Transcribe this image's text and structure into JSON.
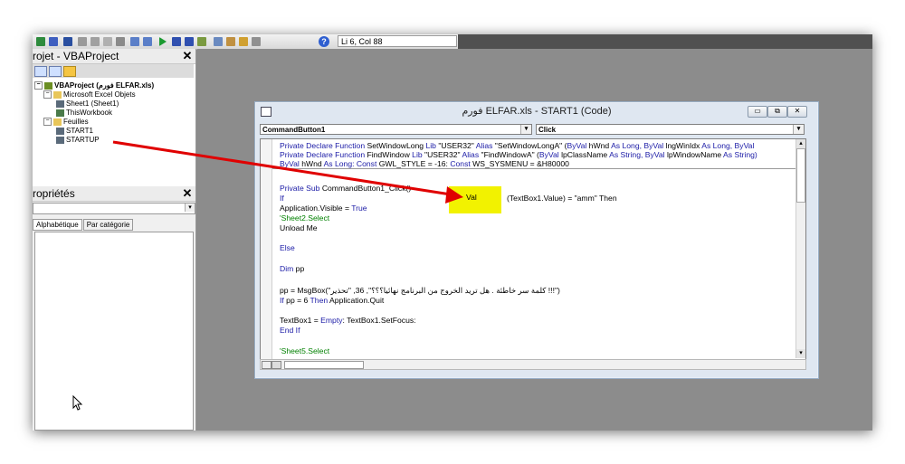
{
  "toolbar": {
    "cursor_position": "Li 6, Col 88",
    "help_glyph": "?"
  },
  "project_panel": {
    "title": "rojet - VBAProject",
    "close_glyph": "✕",
    "tree": [
      {
        "label": "VBAProject (فورم ELFAR.xls)",
        "expander": "−"
      },
      {
        "label": "Microsoft Excel Objets",
        "expander": "−"
      },
      {
        "label": "Sheet1 (Sheet1)"
      },
      {
        "label": "ThisWorkbook"
      },
      {
        "label": "Feuilles",
        "expander": "−"
      },
      {
        "label": "START1"
      },
      {
        "label": "STARTUP"
      }
    ]
  },
  "properties_panel": {
    "title": "ropriétés",
    "close_glyph": "✕",
    "tabs": [
      "Alphabétique",
      "Par catégorie"
    ]
  },
  "code_window": {
    "title": "فورم ELFAR.xls - START1 (Code)",
    "object_combo": "CommandButton1",
    "procedure_combo": "Click",
    "buttons": {
      "minimize": "▭",
      "restore": "⧉",
      "close": "✕"
    }
  },
  "code": {
    "decl1_a": "Private Declare Function",
    "decl1_b": " SetWindowLong ",
    "decl1_c": "Lib",
    "decl1_d": " \"USER32\" ",
    "decl1_e": "Alias",
    "decl1_f": " \"SetWindowLongA\" (",
    "decl1_g": "ByVal",
    "decl1_h": " hWnd ",
    "decl1_i": "As Long, ByVal",
    "decl1_j": " lngWinIdx ",
    "decl1_k": "As Long, ByVal",
    "decl2_a": "Private Declare Function",
    "decl2_b": " FindWindow ",
    "decl2_c": "Lib",
    "decl2_d": " \"USER32\" ",
    "decl2_e": "Alias",
    "decl2_f": " \"FindWindowA\" (",
    "decl2_g": "ByVal",
    "decl2_h": " lpClassName ",
    "decl2_i": "As String, ByVal",
    "decl2_j": " lpWindowName ",
    "decl2_k": "As String)",
    "decl3_a": "ByVal",
    "decl3_b": " hWnd ",
    "decl3_c": "As Long: Const",
    "decl3_d": " GWL_STYLE = -16: ",
    "decl3_e": "Const",
    "decl3_f": " WS_SYSMENU = &H80000",
    "sub_a": "Private Sub",
    "sub_b": " CommandButton1_Click()",
    "if_kw": "If",
    "if_rest": "(TextBox1.Value) = \"amm\" Then",
    "val": "Val",
    "app_a": "Application.Visible = ",
    "app_b": "True",
    "sheet2": "'Sheet2.Select",
    "unload": "Unload Me",
    "else": "Else",
    "dim_a": "Dim",
    "dim_b": " pp",
    "msg": "pp = MsgBox(\"كلمة سر خاطئة . هل تريد الخروج من البرنامج نهائيا؟؟؟\", 36, \"تحذير !!!\")",
    "ifpp_a": "If",
    "ifpp_b": " pp = 6 ",
    "ifpp_c": "Then",
    "ifpp_d": " Application.Quit",
    "tb_a": "TextBox1 = ",
    "tb_b": "Empty",
    "tb_c": ": TextBox1.SetFocus:",
    "endif": "End If",
    "sheet5": "'Sheet5.Select"
  },
  "colors": {
    "keyword": "#1a1aa6",
    "comment": "#008000",
    "highlight": "#f2f200",
    "arrow": "#e00000"
  }
}
